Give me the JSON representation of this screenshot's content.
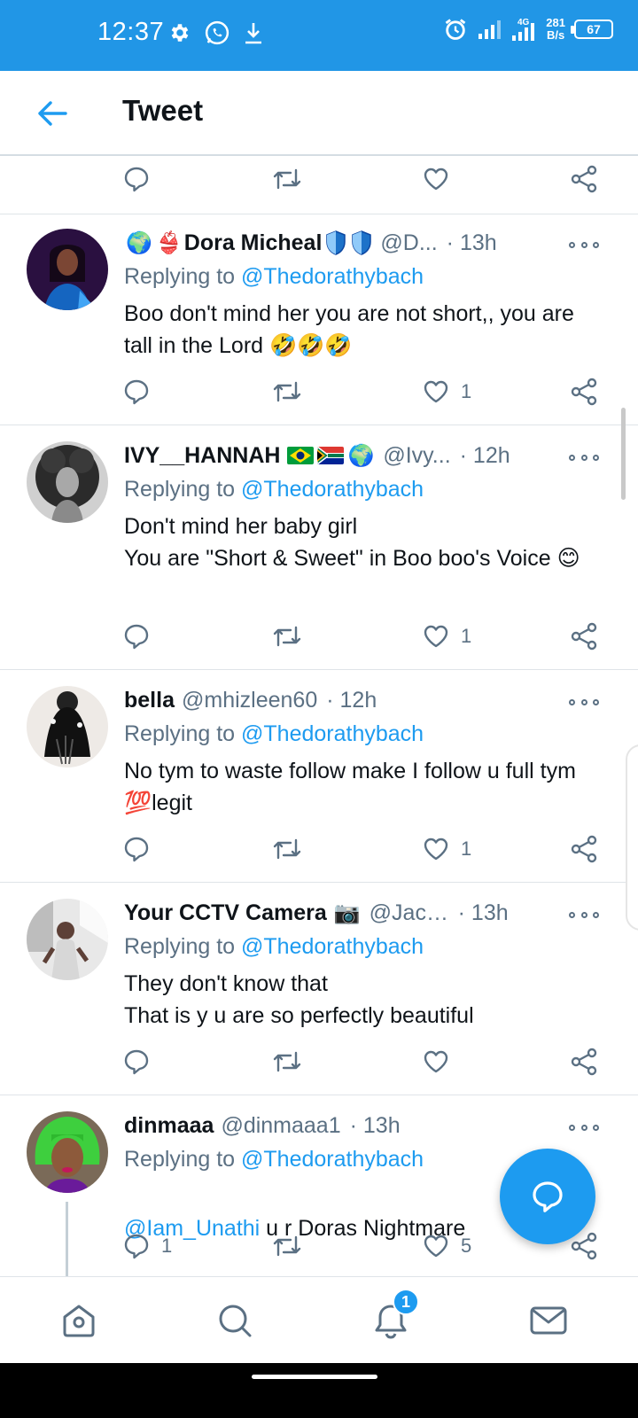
{
  "status_bar": {
    "time": "12:37",
    "network_speed_value": "281",
    "network_speed_unit": "B/s",
    "network_type": "4G",
    "battery": "67",
    "icons": [
      "settings-icon",
      "whatsapp-icon",
      "download-icon",
      "alarm-icon",
      "signal-icon",
      "signal-4g-icon"
    ]
  },
  "header": {
    "title": "Tweet",
    "back_icon": "arrow-left-icon"
  },
  "colors": {
    "status_bar": "#2196e6",
    "accent": "#1d9bf0",
    "secondary_text": "#5b7083"
  },
  "tweets": [
    {
      "prefix_emojis": [
        "🌍",
        "👙"
      ],
      "name": "Dora Micheal",
      "handle": "@D...",
      "time": "· 13h",
      "replying_label": "Replying to",
      "replying_to": "@Thedorathybach",
      "body": "Boo don't mind her you are not short,, you are tall in the Lord 🤣🤣🤣",
      "likes": "1",
      "replies": "",
      "avatar_colors": [
        "#2a1040",
        "#1565c0"
      ]
    },
    {
      "name": "IVY__HANNAH",
      "suffix_emoji": "🌍",
      "handle": "@Ivy...",
      "time": "· 12h",
      "replying_label": "Replying to",
      "replying_to": "@Thedorathybach",
      "body": "Don't mind her baby girl\nYou are  \"Short & Sweet\"  in Boo boo's Voice 😊",
      "likes": "1",
      "replies": "",
      "avatar_colors": [
        "#333333",
        "#9e9e9e"
      ]
    },
    {
      "name": "bella",
      "handle": "@mhizleen60",
      "time": "· 12h",
      "replying_label": "Replying to",
      "replying_to": "@Thedorathybach",
      "body": "No tym to waste follow make I follow u full tym 💯legit",
      "likes": "1",
      "replies": "",
      "avatar_colors": [
        "#eeeeee",
        "#111111"
      ]
    },
    {
      "name": "Your CCTV Camera",
      "suffix_emoji": "📷",
      "handle": "@Jack...",
      "time": "· 13h",
      "replying_label": "Replying to",
      "replying_to": "@Thedorathybach",
      "body": "They don't know that\nThat is y u are so perfectly beautiful",
      "likes": "",
      "replies": "",
      "avatar_colors": [
        "#e0e0e0",
        "#6d4c41"
      ]
    },
    {
      "name": "dinmaaa",
      "handle": "@dinmaaa1",
      "time": "· 13h",
      "replying_label": "Replying to",
      "replying_to": "@Thedorathybach",
      "body_mention": "@Iam_Unathi",
      "body_text": " u r Doras Nightmare",
      "likes": "5",
      "replies": "1",
      "avatar_colors": [
        "#3ecf3e",
        "#7b4a2c"
      ]
    }
  ],
  "bottom_nav": {
    "items": [
      "home-icon",
      "search-icon",
      "notifications-icon",
      "messages-icon"
    ],
    "notification_badge": "1"
  },
  "fab": {
    "icon": "compose-reply-icon"
  }
}
